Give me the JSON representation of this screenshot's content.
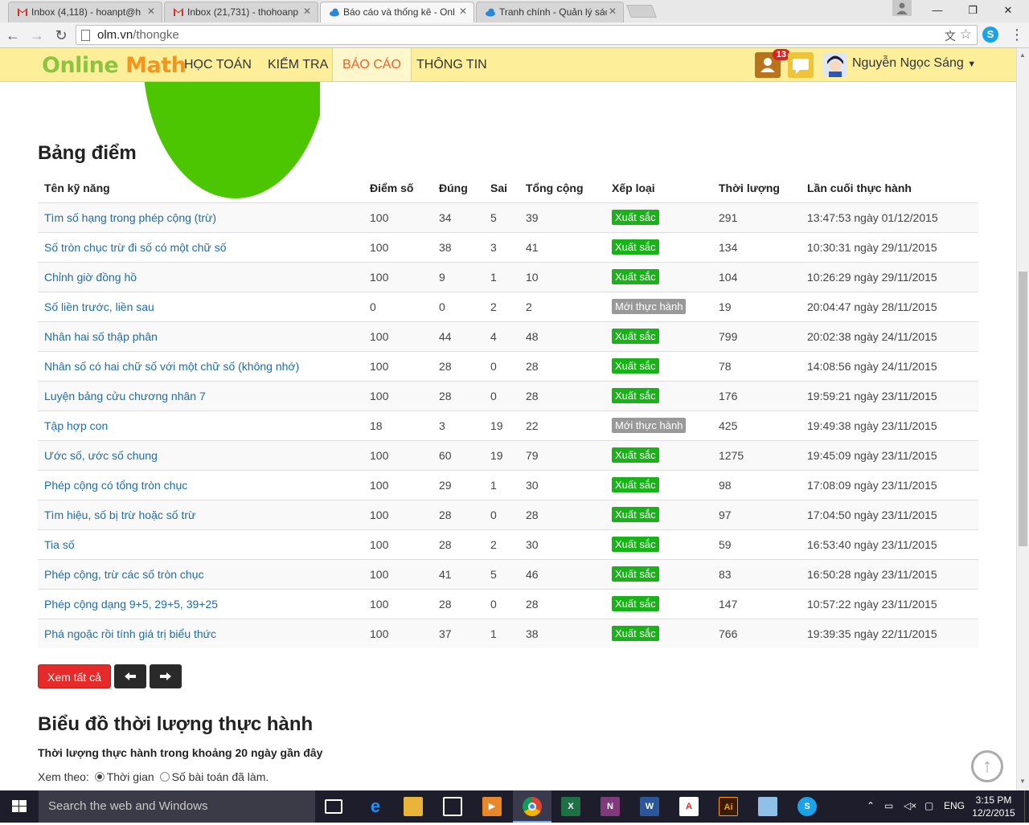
{
  "browser": {
    "tabs": [
      {
        "title": "Inbox (4,118) - hoanpt@h",
        "icon": "gmail-icon"
      },
      {
        "title": "Inbox (21,731) - thohoanp",
        "icon": "gmail-icon"
      },
      {
        "title": "Báo cáo và thống kê - Onl",
        "icon": "cloud-icon"
      },
      {
        "title": "Tranh chính - Quản lý sách",
        "icon": "cloud-icon"
      }
    ],
    "active_tab": 2,
    "url_host": "olm.vn",
    "url_path": "/thongke"
  },
  "site": {
    "logo_part1": "Online",
    "logo_part2": "Math",
    "nav": [
      "HỌC TOÁN",
      "KIỂM TRA",
      "BÁO CÁO",
      "THÔNG TIN"
    ],
    "active_nav": 2,
    "notification_count": "13",
    "username": "Nguyễn Ngọc Sáng"
  },
  "scoreboard": {
    "title": "Bảng điểm",
    "columns": [
      "Tên kỹ năng",
      "Điểm số",
      "Đúng",
      "Sai",
      "Tổng cộng",
      "Xếp loại",
      "Thời lượng",
      "Lần cuối thực hành"
    ],
    "rows": [
      {
        "skill": "Tìm số hạng trong phép cộng (trừ)",
        "score": "100",
        "correct": "34",
        "wrong": "5",
        "total": "39",
        "rank": "Xuất sắc",
        "rank_type": "ok",
        "duration": "291",
        "last": "13:47:53 ngày 01/12/2015"
      },
      {
        "skill": "Số tròn chục trừ đi số có một chữ số",
        "score": "100",
        "correct": "38",
        "wrong": "3",
        "total": "41",
        "rank": "Xuất sắc",
        "rank_type": "ok",
        "duration": "134",
        "last": "10:30:31 ngày 29/11/2015"
      },
      {
        "skill": "Chỉnh giờ đồng hồ",
        "score": "100",
        "correct": "9",
        "wrong": "1",
        "total": "10",
        "rank": "Xuất sắc",
        "rank_type": "ok",
        "duration": "104",
        "last": "10:26:29 ngày 29/11/2015"
      },
      {
        "skill": "Số liền trước, liền sau",
        "score": "0",
        "correct": "0",
        "wrong": "2",
        "total": "2",
        "rank": "Mới thực hành",
        "rank_type": "new",
        "duration": "19",
        "last": "20:04:47 ngày 28/11/2015"
      },
      {
        "skill": "Nhân hai số thập phân",
        "score": "100",
        "correct": "44",
        "wrong": "4",
        "total": "48",
        "rank": "Xuất sắc",
        "rank_type": "ok",
        "duration": "799",
        "last": "20:02:38 ngày 24/11/2015"
      },
      {
        "skill": "Nhân số có hai chữ số với một chữ số (không nhớ)",
        "score": "100",
        "correct": "28",
        "wrong": "0",
        "total": "28",
        "rank": "Xuất sắc",
        "rank_type": "ok",
        "duration": "78",
        "last": "14:08:56 ngày 24/11/2015"
      },
      {
        "skill": "Luyện bảng cửu chương nhân 7",
        "score": "100",
        "correct": "28",
        "wrong": "0",
        "total": "28",
        "rank": "Xuất sắc",
        "rank_type": "ok",
        "duration": "176",
        "last": "19:59:21 ngày 23/11/2015"
      },
      {
        "skill": "Tập hợp con",
        "score": "18",
        "correct": "3",
        "wrong": "19",
        "total": "22",
        "rank": "Mới thực hành",
        "rank_type": "new",
        "duration": "425",
        "last": "19:49:38 ngày 23/11/2015"
      },
      {
        "skill": "Ước số, ước số chung",
        "score": "100",
        "correct": "60",
        "wrong": "19",
        "total": "79",
        "rank": "Xuất sắc",
        "rank_type": "ok",
        "duration": "1275",
        "last": "19:45:09 ngày 23/11/2015"
      },
      {
        "skill": "Phép cộng có tổng tròn chục",
        "score": "100",
        "correct": "29",
        "wrong": "1",
        "total": "30",
        "rank": "Xuất sắc",
        "rank_type": "ok",
        "duration": "98",
        "last": "17:08:09 ngày 23/11/2015"
      },
      {
        "skill": "Tìm hiệu, số bị trừ hoặc số trừ",
        "score": "100",
        "correct": "28",
        "wrong": "0",
        "total": "28",
        "rank": "Xuất sắc",
        "rank_type": "ok",
        "duration": "97",
        "last": "17:04:50 ngày 23/11/2015"
      },
      {
        "skill": "Tia số",
        "score": "100",
        "correct": "28",
        "wrong": "2",
        "total": "30",
        "rank": "Xuất sắc",
        "rank_type": "ok",
        "duration": "59",
        "last": "16:53:40 ngày 23/11/2015"
      },
      {
        "skill": "Phép cộng, trừ các số tròn chục",
        "score": "100",
        "correct": "41",
        "wrong": "5",
        "total": "46",
        "rank": "Xuất sắc",
        "rank_type": "ok",
        "duration": "83",
        "last": "16:50:28 ngày 23/11/2015"
      },
      {
        "skill": "Phép cộng dạng 9+5, 29+5, 39+25",
        "score": "100",
        "correct": "28",
        "wrong": "0",
        "total": "28",
        "rank": "Xuất sắc",
        "rank_type": "ok",
        "duration": "147",
        "last": "10:57:22 ngày 23/11/2015"
      },
      {
        "skill": "Phá ngoặc rồi tính giá trị biểu thức",
        "score": "100",
        "correct": "37",
        "wrong": "1",
        "total": "38",
        "rank": "Xuất sắc",
        "rank_type": "ok",
        "duration": "766",
        "last": "19:39:35 ngày 22/11/2015"
      }
    ],
    "view_all_label": "Xem tất cả",
    "prev_icon": "arrow-left-icon",
    "next_icon": "arrow-right-icon"
  },
  "chart_section": {
    "title": "Biểu đồ thời lượng thực hành",
    "subtitle": "Thời lượng thực hành trong khoảng 20 ngày gần đây",
    "view_by_label": "Xem theo:",
    "options": [
      "Thời gian",
      "Số bài toán đã làm."
    ],
    "selected_option": 0
  },
  "colors": {
    "header_bg": "#fdef9a",
    "rank_ok": "#19b319",
    "rank_new": "#999999",
    "link": "#1f6ca8",
    "btn_red": "#e62a2a"
  },
  "taskbar": {
    "search_placeholder": "Search the web and Windows",
    "language": "ENG",
    "time": "3:15 PM",
    "date": "12/2/2015"
  }
}
